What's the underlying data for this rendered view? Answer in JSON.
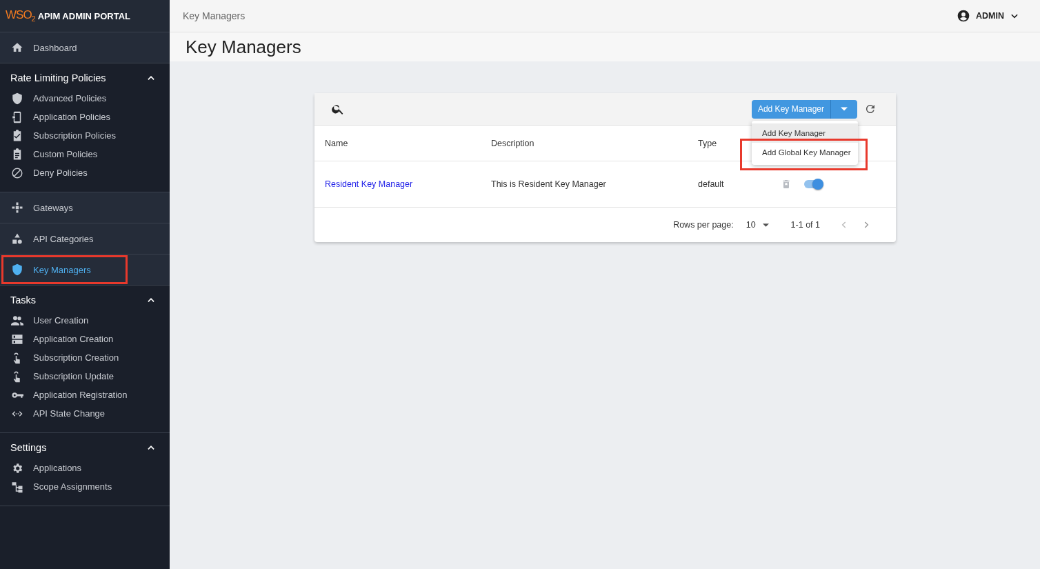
{
  "brand": {
    "logo": "WSO$_{2}$",
    "title": "APIM ADMIN PORTAL"
  },
  "sidebar": {
    "sections": [
      {
        "kind": "link",
        "items": [
          {
            "label": "Dashboard",
            "selected": false,
            "highlighted": false
          }
        ]
      },
      {
        "kind": "group",
        "title": "Rate Limiting Policies",
        "expanded": true,
        "items": [
          {
            "label": "Advanced Policies",
            "selected": false,
            "highlighted": false
          },
          {
            "label": "Application Policies",
            "selected": false,
            "highlighted": false
          },
          {
            "label": "Subscription Policies",
            "selected": false,
            "highlighted": false
          },
          {
            "label": "Custom Policies",
            "selected": false,
            "highlighted": false
          },
          {
            "label": "Deny Policies",
            "selected": false,
            "highlighted": false
          }
        ]
      },
      {
        "kind": "link",
        "items": [
          {
            "label": "Gateways",
            "selected": false,
            "highlighted": false
          }
        ]
      },
      {
        "kind": "link",
        "items": [
          {
            "label": "API Categories",
            "selected": false,
            "highlighted": false
          }
        ]
      },
      {
        "kind": "link",
        "items": [
          {
            "label": "Key Managers",
            "selected": true,
            "highlighted": true
          }
        ]
      },
      {
        "kind": "group",
        "title": "Tasks",
        "expanded": true,
        "items": [
          {
            "label": "User Creation",
            "selected": false,
            "highlighted": false
          },
          {
            "label": "Application Creation",
            "selected": false,
            "highlighted": false
          },
          {
            "label": "Subscription Creation",
            "selected": false,
            "highlighted": false
          },
          {
            "label": "Subscription Update",
            "selected": false,
            "highlighted": false
          },
          {
            "label": "Application Registration",
            "selected": false,
            "highlighted": false
          },
          {
            "label": "API State Change",
            "selected": false,
            "highlighted": false
          }
        ]
      },
      {
        "kind": "group",
        "title": "Settings",
        "expanded": true,
        "items": [
          {
            "label": "Applications",
            "selected": false,
            "highlighted": false
          },
          {
            "label": "Scope Assignments",
            "selected": false,
            "highlighted": false
          }
        ]
      }
    ]
  },
  "header": {
    "breadcrumb": "Key Managers",
    "user": "ADMIN"
  },
  "page_title": "Key Managers",
  "table": {
    "add_button": "Add Key Manager",
    "menu": {
      "open": true,
      "items": [
        {
          "label": "Add Key Manager",
          "hovered": true,
          "highlighted": false
        },
        {
          "label": "Add Global Key Manager",
          "hovered": false,
          "highlighted": true
        }
      ]
    },
    "columns": [
      "Name",
      "Description",
      "Type"
    ],
    "rows": [
      {
        "name": "Resident Key Manager",
        "description": "This is Resident Key Manager",
        "type": "default",
        "enabled": true
      }
    ],
    "footer": {
      "rows_per_page_label": "Rows per page:",
      "rows_per_page": "10",
      "range": "1-1 of 1"
    }
  }
}
